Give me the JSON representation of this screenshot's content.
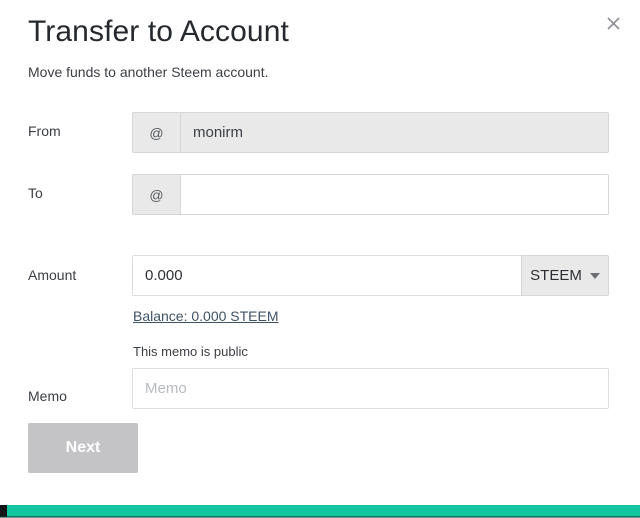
{
  "dialog": {
    "title": "Transfer to Account",
    "subtitle": "Move funds to another Steem account.",
    "close_icon": "close-icon"
  },
  "form": {
    "rows": [
      {
        "label": "From",
        "addon": "@",
        "value": "monirm",
        "placeholder": "",
        "disabled": true
      },
      {
        "label": "To",
        "addon": "@",
        "value": "",
        "placeholder": "",
        "disabled": false
      }
    ],
    "amount": {
      "label": "Amount",
      "value": "0.000",
      "placeholder": "0.000",
      "asset": "STEEM",
      "caret_icon": "chevron-down-icon",
      "balance_link": "Balance: 0.000 STEEM"
    },
    "memo": {
      "label": "Memo",
      "note": "This memo is public",
      "value": "",
      "placeholder": "Memo"
    }
  },
  "actions": {
    "next_label": "Next"
  },
  "colors": {
    "accent": "#13c6a0",
    "link": "#3f5366",
    "disabled_button": "#c4c4c6",
    "field_disabled_bg": "#e9e9e9",
    "border": "#d6d6d6"
  }
}
